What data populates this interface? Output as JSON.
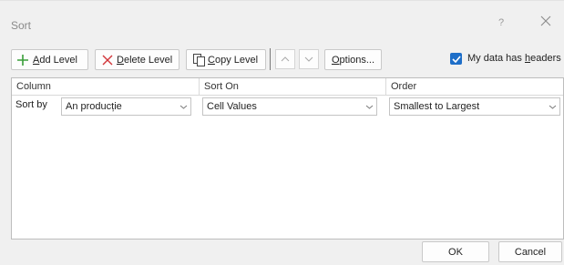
{
  "dialog": {
    "title": "Sort",
    "help_label": "?",
    "close_label": "close"
  },
  "toolbar": {
    "add_level": {
      "accel": "A",
      "rest": "dd Level",
      "icon": "plus-icon"
    },
    "delete_level": {
      "accel": "D",
      "rest": "elete Level",
      "icon": "x-icon"
    },
    "copy_level": {
      "accel": "C",
      "rest": "opy Level",
      "icon": "copy-icon"
    },
    "move_up_icon": "chevron-up-icon",
    "move_down_icon": "chevron-down-icon",
    "options": {
      "accel": "O",
      "rest": "ptions..."
    },
    "headers_checkbox": {
      "checked": true,
      "label_pre": "My data has ",
      "label_accel": "h",
      "label_post": "eaders"
    }
  },
  "grid": {
    "columns": [
      "Column",
      "Sort On",
      "Order"
    ],
    "rows": [
      {
        "label": "Sort by",
        "column": "An producție",
        "sort_on": "Cell Values",
        "order": "Smallest to Largest"
      }
    ]
  },
  "footer": {
    "ok_label": "OK",
    "cancel_label": "Cancel"
  },
  "colors": {
    "accent": "#1e6ec8",
    "add_icon": "#3a9e3a",
    "delete_icon": "#d13438"
  }
}
